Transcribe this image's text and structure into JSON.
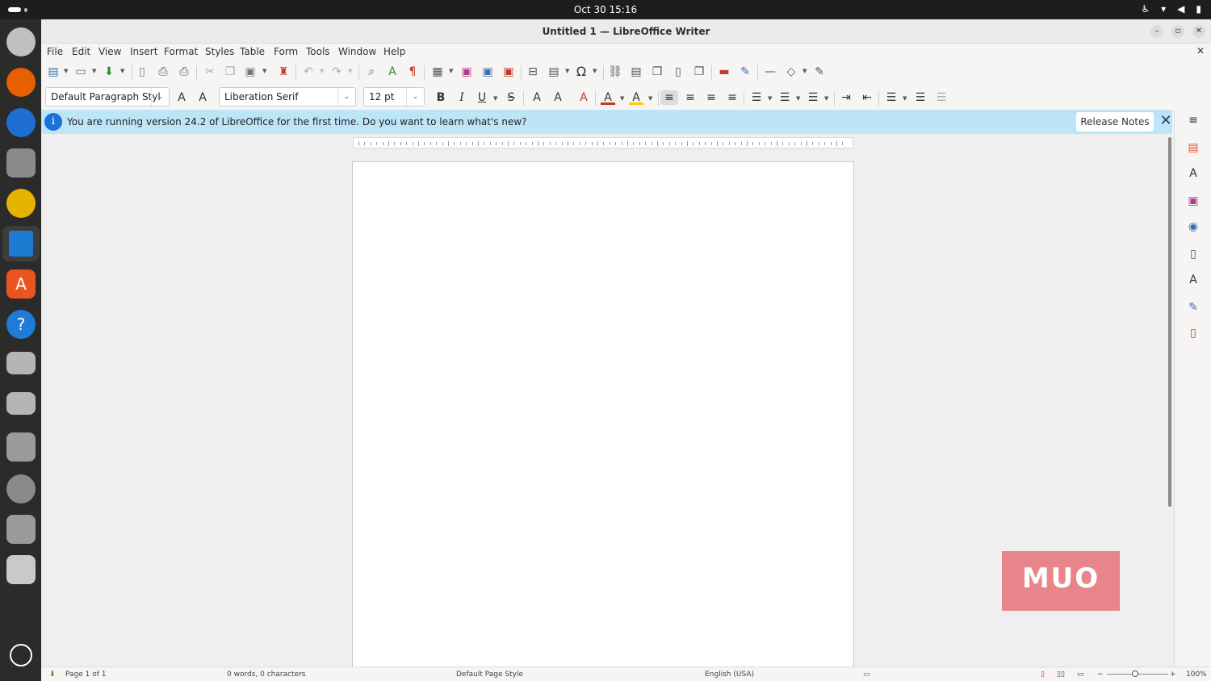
{
  "system": {
    "clock": "Oct 30  15:16"
  },
  "dock": {
    "items": [
      "ubuntu-updates",
      "firefox",
      "thunderbird",
      "files",
      "rhythmbox",
      "libreoffice-writer",
      "app-center",
      "help",
      "drive-1",
      "drive-2",
      "ssd",
      "optical-drive",
      "usb",
      "trash",
      "show-apps"
    ]
  },
  "window": {
    "title": "Untitled 1 — LibreOffice Writer"
  },
  "menu": {
    "items": [
      "File",
      "Edit",
      "View",
      "Insert",
      "Format",
      "Styles",
      "Table",
      "Form",
      "Tools",
      "Window",
      "Help"
    ]
  },
  "formatting": {
    "paragraph_style": "Default Paragraph Styl",
    "font_name": "Liberation Serif",
    "font_size": "12 pt"
  },
  "infobar": {
    "message": "You are running version 24.2 of LibreOffice for the first time. Do you want to learn what's new?",
    "button_label": "Release Notes"
  },
  "watermark": {
    "text": "MUO"
  },
  "status": {
    "page": "Page 1 of 1",
    "counts": "0 words, 0 characters",
    "page_style": "Default Page Style",
    "language": "English (USA)",
    "zoom": "100%"
  },
  "colors": {
    "infobar_bg": "#bde5f8",
    "accent": "#1c71d8"
  }
}
